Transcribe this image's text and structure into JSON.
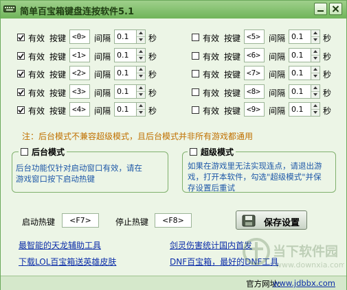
{
  "window": {
    "title": "简单百宝箱键盘连按软件5.1",
    "minimize_icon": "minimize-icon",
    "close_icon": "close-icon"
  },
  "labels": {
    "valid": "有效",
    "key": "按键",
    "interval": "间隔",
    "sec": "秒"
  },
  "rows_left": [
    {
      "checked": true,
      "key": "<0>",
      "interval": "0.1"
    },
    {
      "checked": true,
      "key": "<1>",
      "interval": "0.1"
    },
    {
      "checked": true,
      "key": "<2>",
      "interval": "0.1"
    },
    {
      "checked": true,
      "key": "<3>",
      "interval": "0.1"
    },
    {
      "checked": true,
      "key": "<4>",
      "interval": "0.1"
    }
  ],
  "rows_right": [
    {
      "checked": false,
      "key": "<5>",
      "interval": "0.1"
    },
    {
      "checked": false,
      "key": "<6>",
      "interval": "0.1"
    },
    {
      "checked": false,
      "key": "<7>",
      "interval": "0.1"
    },
    {
      "checked": false,
      "key": "<8>",
      "interval": "0.1"
    },
    {
      "checked": false,
      "key": "<9>",
      "interval": "0.1"
    }
  ],
  "note": "注：后台模式不兼容超级模式，且后台模式并非所有游戏都通用",
  "background_mode": {
    "title": "后台模式",
    "checked": false,
    "desc_line1": "后台功能仅针对启动窗口有效，请在",
    "desc_line2": "游戏窗口按下启动热键"
  },
  "super_mode": {
    "title": "超级模式",
    "checked": false,
    "desc_line1": "如果在游戏里无法实现连点，请退出游",
    "desc_line2": "戏，打开本软件，勾选\"超级模式\"并保",
    "desc_line3": "存设置后重试"
  },
  "hotkeys": {
    "start_label": "启动热键",
    "start_value": "<F7>",
    "stop_label": "停止热键",
    "stop_value": "<F8>"
  },
  "save_button": "保存设置",
  "links": {
    "l1": "最智能的天龙辅助工具",
    "l2": "下载LOL百宝箱送英雄皮肤",
    "r1": "剑灵伤害统计国内首发",
    "r2": "DNF百宝箱，最好的DNF工具"
  },
  "footer": {
    "site_label": "官方网址:",
    "site_url": "www.jdbbx.com"
  },
  "watermark": {
    "text_cn": "当下软件园",
    "text_en": "www.downxia.com"
  }
}
